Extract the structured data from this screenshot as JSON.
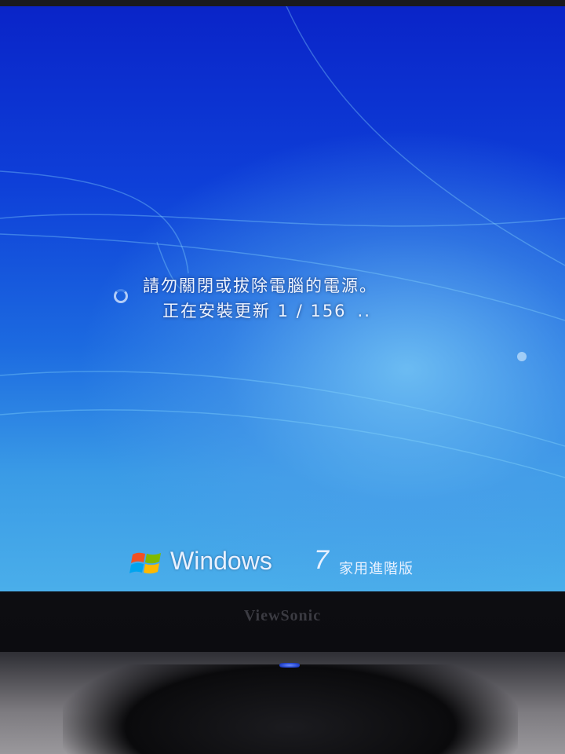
{
  "update_screen": {
    "warning_text": "請勿關閉或拔除電腦的電源。",
    "progress_label": "正在安裝更新 1 / 156",
    "progress_dots": "..",
    "progress": {
      "current": 1,
      "total": 156
    }
  },
  "branding": {
    "product": "Windows",
    "version": "7",
    "edition": "家用進階版"
  },
  "monitor": {
    "vendor": "ViewSonic"
  },
  "icons": [
    "loading-spinner-icon",
    "windows-logo-icon",
    "power-led-icon"
  ],
  "colors": {
    "screen_blue": "#0e3fd8",
    "screen_light_blue": "#4aaeea",
    "text": "#eef4ff"
  }
}
